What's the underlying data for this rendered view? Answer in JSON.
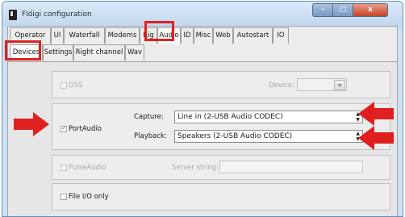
{
  "window": {
    "title": "Fldigi configuration",
    "buttons": {
      "minimize": "–",
      "maximize": "□",
      "close": "x"
    }
  },
  "main_tabs": [
    "Operator",
    "UI",
    "Waterfall",
    "Modems",
    "Rig",
    "Audio",
    "ID",
    "Misc",
    "Web",
    "Autostart",
    "IO"
  ],
  "main_active": "Audio",
  "sub_tabs": [
    "Devices",
    "Settings",
    "Right channel",
    "Wav"
  ],
  "sub_active": "Devices",
  "oss": {
    "label": "OSS",
    "checked": false,
    "enabled": false,
    "device_label": "Device:",
    "device_value": ""
  },
  "portaudio": {
    "label": "PortAudio",
    "checked": true,
    "capture_label": "Capture:",
    "capture_value": "Line in (2-USB Audio CODEC)",
    "playback_label": "Playback:",
    "playback_value": "Speakers (2-USB Audio CODEC)"
  },
  "pulseaudio": {
    "label": "PulseAudio",
    "checked": false,
    "enabled": false,
    "server_label": "Server string:",
    "server_value": ""
  },
  "fileio": {
    "label": "File I/O only",
    "checked": false
  },
  "colors": {
    "highlight": "#e02020",
    "window_frame": "#cfe0f1",
    "check": "#5c6bb0"
  }
}
